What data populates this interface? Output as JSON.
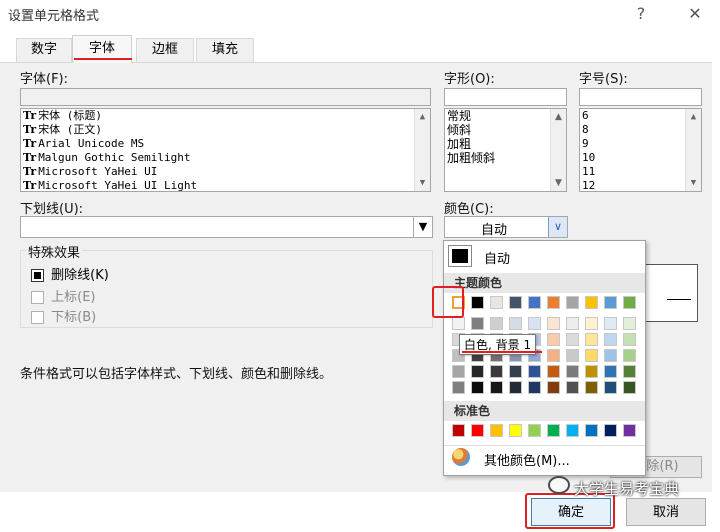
{
  "window": {
    "title": "设置单元格格式",
    "help": "?",
    "close": "✕"
  },
  "tabs": [
    {
      "label": "数字"
    },
    {
      "label": "字体"
    },
    {
      "label": "边框"
    },
    {
      "label": "填充"
    }
  ],
  "font": {
    "label": "字体(F):",
    "value": "",
    "list": [
      "宋体 (标题)",
      "宋体 (正文)",
      "Arial Unicode MS",
      "Malgun Gothic Semilight",
      "Microsoft YaHei UI",
      "Microsoft YaHei UI Light"
    ],
    "icon_text": "Tr"
  },
  "style": {
    "label": "字形(O):",
    "value": "",
    "list": [
      "常规",
      "倾斜",
      "加粗",
      "加粗倾斜"
    ]
  },
  "size": {
    "label": "字号(S):",
    "value": "",
    "list": [
      "6",
      "8",
      "9",
      "10",
      "11",
      "12"
    ]
  },
  "underline": {
    "label": "下划线(U):",
    "value": ""
  },
  "color": {
    "label": "颜色(C):",
    "value": "自动"
  },
  "effects": {
    "label": "特殊效果",
    "items": [
      {
        "label": "删除线(K)",
        "checked": true,
        "enabled": true
      },
      {
        "label": "上标(E)",
        "checked": false,
        "enabled": false
      },
      {
        "label": "下标(B)",
        "checked": false,
        "enabled": false
      }
    ]
  },
  "info_text": "条件格式可以包括字体样式、下划线、颜色和删除线。",
  "clear_button": "清除(R)",
  "popup": {
    "auto_label": "自动",
    "theme_header": "主题颜色",
    "standard_header": "标准色",
    "more_colors": "其他颜色(M)...",
    "tooltip": "白色, 背景 1",
    "theme_top": [
      "#ffffff",
      "#000000",
      "#e7e6e6",
      "#44546a",
      "#4472c4",
      "#ed7d31",
      "#a5a5a5",
      "#ffc000",
      "#5b9bd5",
      "#70ad47"
    ],
    "theme_shades": [
      [
        "#f2f2f2",
        "#7f7f7f",
        "#d0cece",
        "#d6dce4",
        "#d9e2f3",
        "#fbe5d5",
        "#ededed",
        "#fff2cc",
        "#deebf6",
        "#e2efd9"
      ],
      [
        "#d8d8d8",
        "#595959",
        "#aeabab",
        "#adb9ca",
        "#b4c6e7",
        "#f7cbac",
        "#dbdbdb",
        "#fee599",
        "#bdd7ee",
        "#c5e0b3"
      ],
      [
        "#bfbfbf",
        "#3f3f3f",
        "#757070",
        "#8496b0",
        "#8eaadb",
        "#f4b183",
        "#c9c9c9",
        "#ffd965",
        "#9dc3e6",
        "#a8d08d"
      ],
      [
        "#a5a5a5",
        "#262626",
        "#3a3838",
        "#323f4f",
        "#2f5496",
        "#c55a11",
        "#7b7b7b",
        "#bf9000",
        "#2e75b5",
        "#538135"
      ],
      [
        "#7f7f7f",
        "#0c0c0c",
        "#171616",
        "#222a35",
        "#1f3864",
        "#833c0b",
        "#525252",
        "#7f6000",
        "#1e4e79",
        "#375623"
      ]
    ],
    "standard": [
      "#c00000",
      "#ff0000",
      "#ffc000",
      "#ffff00",
      "#92d050",
      "#00b050",
      "#00b0f0",
      "#0070c0",
      "#002060",
      "#7030a0"
    ]
  },
  "buttons": {
    "ok": "确定",
    "cancel": "取消"
  },
  "watermark": "大学生易考宝典"
}
